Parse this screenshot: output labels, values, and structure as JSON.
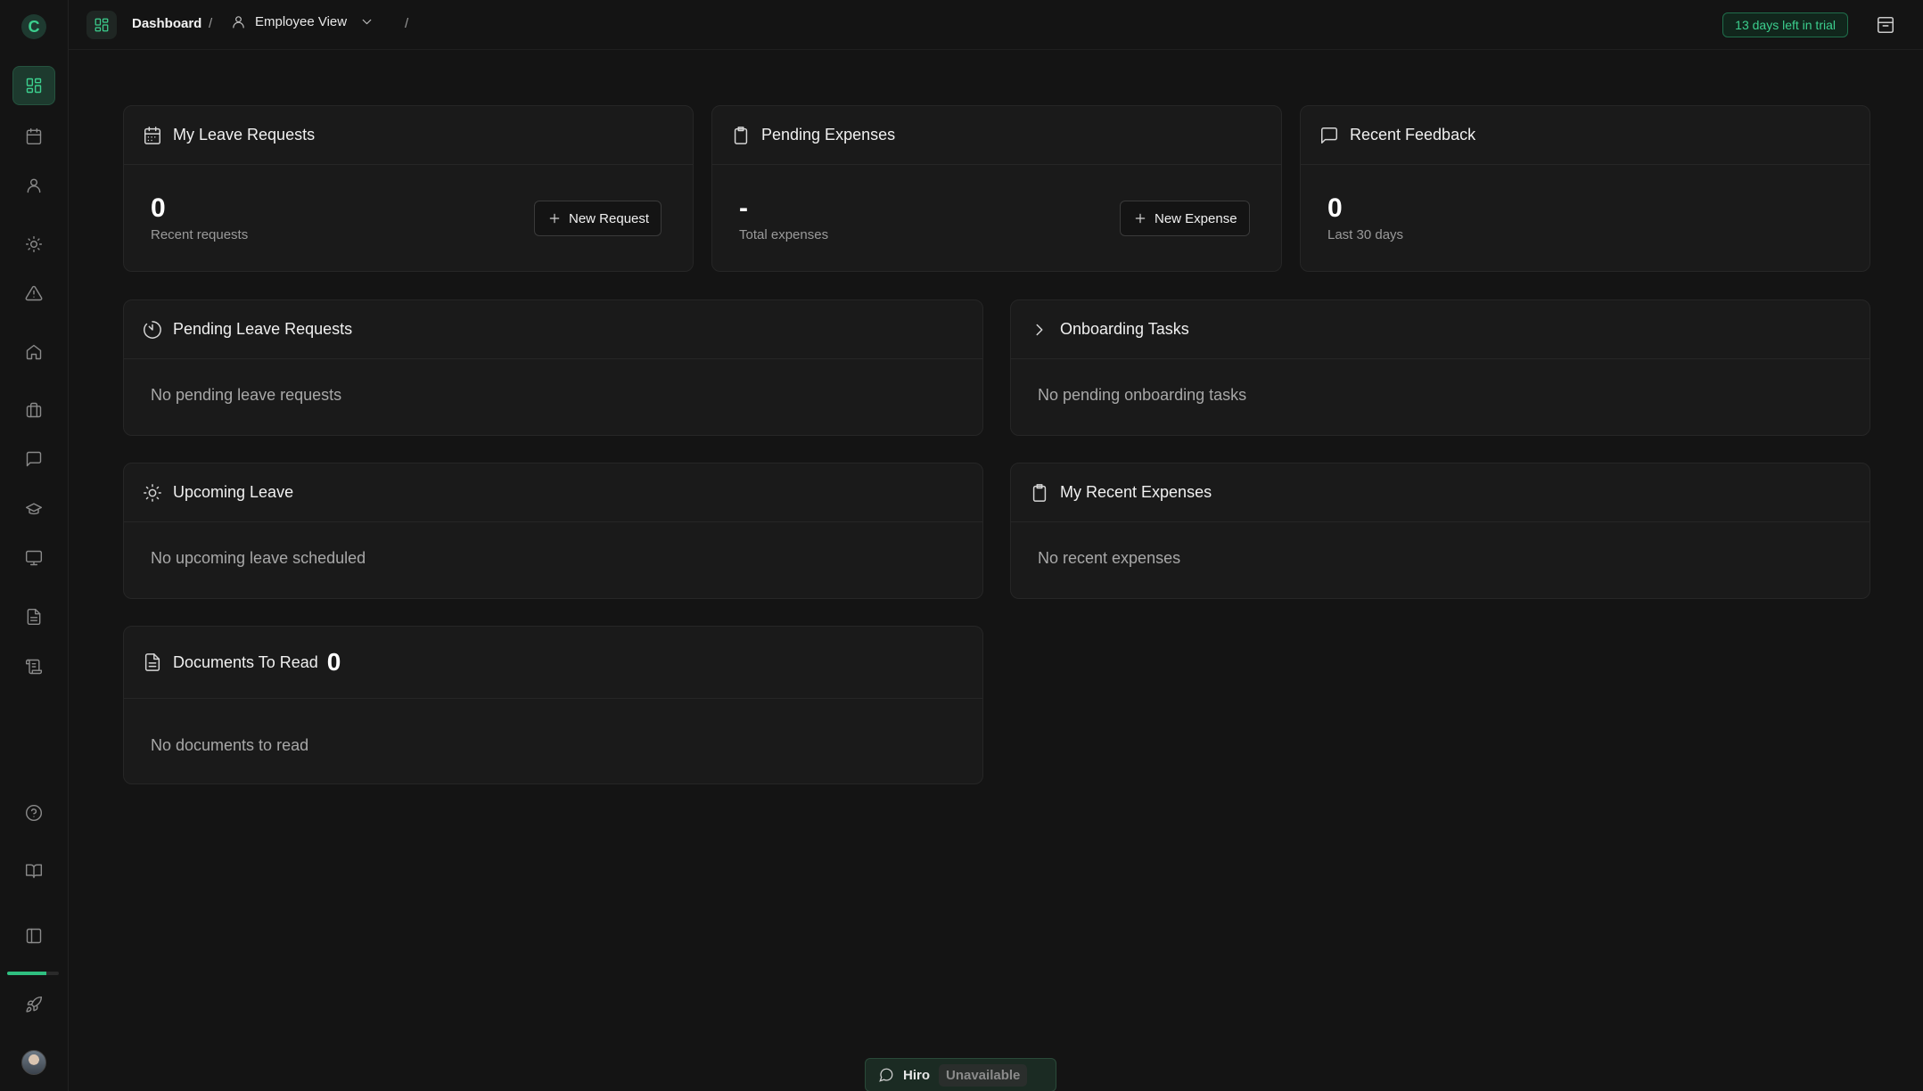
{
  "sidebar": {
    "logo": "C",
    "items": [
      {
        "name": "dashboard",
        "icon": "grid-icon",
        "active": true
      },
      {
        "name": "calendar",
        "icon": "calendar-icon",
        "active": false
      },
      {
        "name": "people",
        "icon": "user-icon",
        "active": false
      },
      {
        "name": "leave",
        "icon": "sun-icon",
        "active": false
      },
      {
        "name": "incidents",
        "icon": "alert-triangle-icon",
        "active": false
      },
      {
        "name": "home",
        "icon": "home-icon",
        "active": false
      },
      {
        "name": "assets",
        "icon": "briefcase-icon",
        "active": false
      },
      {
        "name": "feedback",
        "icon": "message-icon",
        "active": false
      },
      {
        "name": "training",
        "icon": "graduation-cap-icon",
        "active": false
      },
      {
        "name": "devices",
        "icon": "monitor-icon",
        "active": false
      },
      {
        "name": "documents",
        "icon": "file-text-icon",
        "active": false
      },
      {
        "name": "policies",
        "icon": "scroll-icon",
        "active": false
      }
    ],
    "bottom": [
      {
        "name": "help",
        "icon": "help-circle-icon"
      },
      {
        "name": "guide",
        "icon": "book-open-icon"
      },
      {
        "name": "collapse-sidebar",
        "icon": "panel-left-icon"
      },
      {
        "name": "setup",
        "icon": "rocket-icon"
      }
    ],
    "setup_progress": 0.75,
    "accent": "#3ccf8e"
  },
  "topbar": {
    "breadcrumb_home": "Dashboard",
    "separator": "/",
    "view_label": "Employee View",
    "trial_badge": "13 days left in trial"
  },
  "cards": {
    "leave_requests": {
      "title": "My Leave Requests",
      "value": "0",
      "label": "Recent requests",
      "button": "New Request"
    },
    "pending_expenses": {
      "title": "Pending Expenses",
      "value": "-",
      "label": "Total expenses",
      "button": "New Expense"
    },
    "recent_feedback": {
      "title": "Recent Feedback",
      "value": "0",
      "label": "Last 30 days"
    },
    "pending_leave": {
      "title": "Pending Leave Requests",
      "empty": "No pending leave requests"
    },
    "onboarding": {
      "title": "Onboarding Tasks",
      "empty": "No pending onboarding tasks"
    },
    "upcoming_leave": {
      "title": "Upcoming Leave",
      "empty": "No upcoming leave scheduled"
    },
    "recent_expenses": {
      "title": "My Recent Expenses",
      "empty": "No recent expenses"
    },
    "documents": {
      "title": "Documents To Read",
      "count": "0",
      "empty": "No documents to read"
    }
  },
  "assistant": {
    "name": "Hiro",
    "status": "Unavailable"
  }
}
